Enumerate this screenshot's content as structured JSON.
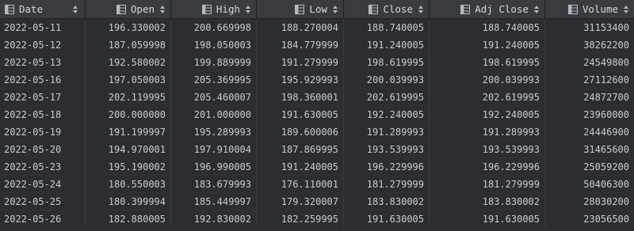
{
  "columns": [
    {
      "key": "date",
      "label": "Date",
      "icon": "table-column-icon",
      "sort_icon": "sort-arrows-icon"
    },
    {
      "key": "open",
      "label": "Open",
      "icon": "table-column-icon",
      "sort_icon": "sort-arrows-icon"
    },
    {
      "key": "high",
      "label": "High",
      "icon": "table-column-icon",
      "sort_icon": "sort-arrows-icon"
    },
    {
      "key": "low",
      "label": "Low",
      "icon": "table-column-icon",
      "sort_icon": "sort-arrows-icon"
    },
    {
      "key": "close",
      "label": "Close",
      "icon": "table-column-icon",
      "sort_icon": "sort-arrows-icon"
    },
    {
      "key": "adj_close",
      "label": "Adj Close",
      "icon": "table-column-icon",
      "sort_icon": "sort-arrows-icon"
    },
    {
      "key": "volume",
      "label": "Volume",
      "icon": "table-column-icon",
      "sort_icon": "sort-arrows-icon"
    }
  ],
  "rows": [
    [
      "2022-05-11",
      "196.330002",
      "200.669998",
      "188.270004",
      "188.740005",
      "188.740005",
      "31153400"
    ],
    [
      "2022-05-12",
      "187.059998",
      "198.050003",
      "184.779999",
      "191.240005",
      "191.240005",
      "38262200"
    ],
    [
      "2022-05-13",
      "192.580002",
      "199.889999",
      "191.279999",
      "198.619995",
      "198.619995",
      "24549800"
    ],
    [
      "2022-05-16",
      "197.050003",
      "205.369995",
      "195.929993",
      "200.039993",
      "200.039993",
      "27112600"
    ],
    [
      "2022-05-17",
      "202.119995",
      "205.460007",
      "198.360001",
      "202.619995",
      "202.619995",
      "24872700"
    ],
    [
      "2022-05-18",
      "200.000000",
      "201.000000",
      "191.630005",
      "192.240005",
      "192.240005",
      "23960000"
    ],
    [
      "2022-05-19",
      "191.199997",
      "195.289993",
      "189.600006",
      "191.289993",
      "191.289993",
      "24446900"
    ],
    [
      "2022-05-20",
      "194.970001",
      "197.910004",
      "187.869995",
      "193.539993",
      "193.539993",
      "31465600"
    ],
    [
      "2022-05-23",
      "195.190002",
      "196.990005",
      "191.240005",
      "196.229996",
      "196.229996",
      "25059200"
    ],
    [
      "2022-05-24",
      "180.550003",
      "183.679993",
      "176.110001",
      "181.279999",
      "181.279999",
      "50406300"
    ],
    [
      "2022-05-25",
      "180.399994",
      "185.449997",
      "179.320007",
      "183.830002",
      "183.830002",
      "28030200"
    ],
    [
      "2022-05-26",
      "182.880005",
      "192.830002",
      "182.259995",
      "191.630005",
      "191.630005",
      "23056500"
    ]
  ],
  "colors": {
    "header_bg": "#393b40",
    "body_bg": "#2b2d30",
    "text": "#c9ccd1",
    "icon": "#b6bac0"
  }
}
